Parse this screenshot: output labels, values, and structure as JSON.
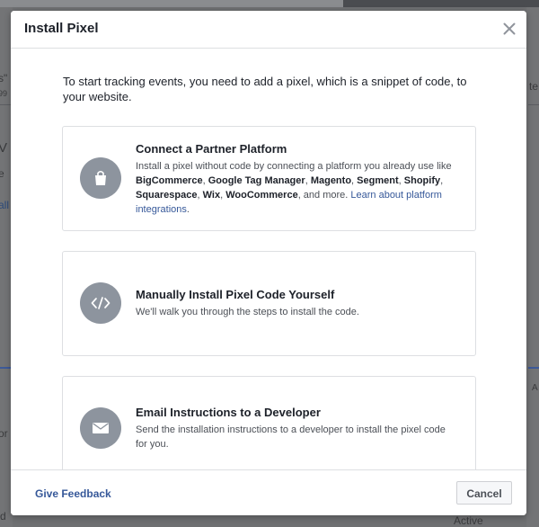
{
  "modal": {
    "title": "Install Pixel",
    "intro": "To start tracking events, you need to add a pixel, which is a snippet of code, to your website."
  },
  "options": [
    {
      "title": "Connect a Partner Platform",
      "icon": "shopping-bag-icon",
      "desc_prefix": "Install a pixel without code by connecting a platform you already use like ",
      "platforms": [
        "BigCommerce",
        "Google Tag Manager",
        "Magento",
        "Segment",
        "Shopify",
        "Squarespace",
        "Wix",
        "WooCommerce"
      ],
      "sep": ", ",
      "desc_suffix": ", and more. ",
      "link": "Learn about platform integrations",
      "link_end": "."
    },
    {
      "title": "Manually Install Pixel Code Yourself",
      "icon": "code-icon",
      "desc": "We'll walk you through the steps to install the code."
    },
    {
      "title": "Email Instructions to a Developer",
      "icon": "envelope-icon",
      "desc": "Send the installation instructions to a developer to install the pixel code for you."
    }
  ],
  "footer": {
    "feedback": "Give Feedback",
    "cancel": "Cancel"
  },
  "background": {
    "frag_left_1": "s\"",
    "frag_left_2": "99",
    "frag_left_3": "V",
    "frag_left_4": "e",
    "frag_left_5": "all",
    "frag_left_6": "or",
    "frag_left_7": "d",
    "frag_right_1": "te",
    "frag_right_2": "A",
    "frag_right_3": "Active"
  },
  "colors": {
    "accent": "#365899",
    "icon_bg": "#8d949e",
    "border": "#dddfe2"
  }
}
